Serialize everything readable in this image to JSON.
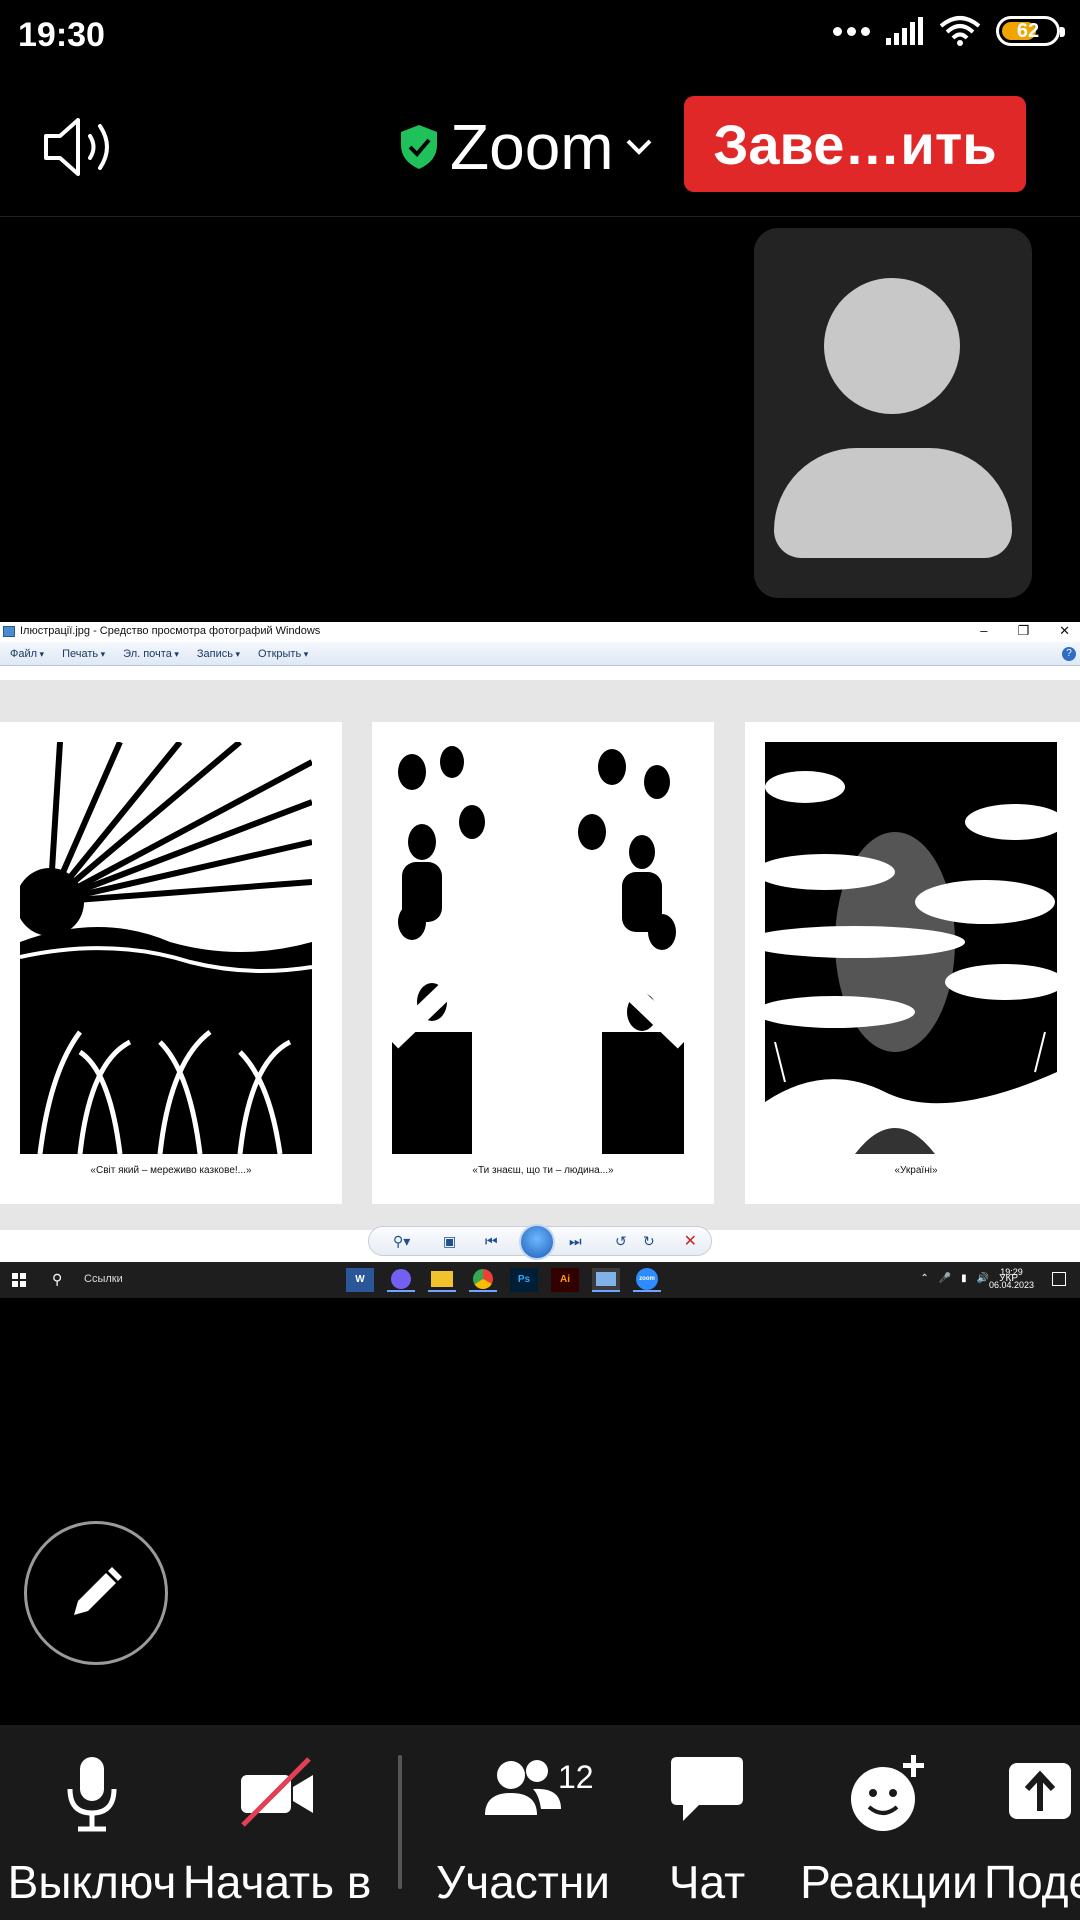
{
  "status_bar": {
    "time": "19:30",
    "battery": "62"
  },
  "zoom_header": {
    "title": "Zoom",
    "end_button": "Заве…ить"
  },
  "shared_window": {
    "title": "Ілюстрації.jpg - Средство просмотра фотографий Windows",
    "menu": [
      "Файл",
      "Печать",
      "Эл. почта",
      "Запись",
      "Открыть"
    ],
    "captions": [
      "«Світ який – мереживо казкове!...»",
      "«Ти знаєш, що ти – людина...»",
      "«Україні»"
    ],
    "taskbar": {
      "search": "Ссылки",
      "lang": "УКР",
      "time": "19:29",
      "date": "06.04.2023",
      "apps": [
        "W",
        "Ps",
        "Ai",
        "zoom"
      ]
    }
  },
  "bottom_toolbar": {
    "mute": "Выключ",
    "video": "Начать в",
    "participants": "Участни",
    "participants_count": "12",
    "chat": "Чат",
    "reactions": "Реакции",
    "share": "Поде"
  },
  "colors": {
    "end_button": "#e02828",
    "shield": "#20c05a",
    "battery": "#f0a400",
    "toolbar_bg": "#1a1a1a"
  }
}
